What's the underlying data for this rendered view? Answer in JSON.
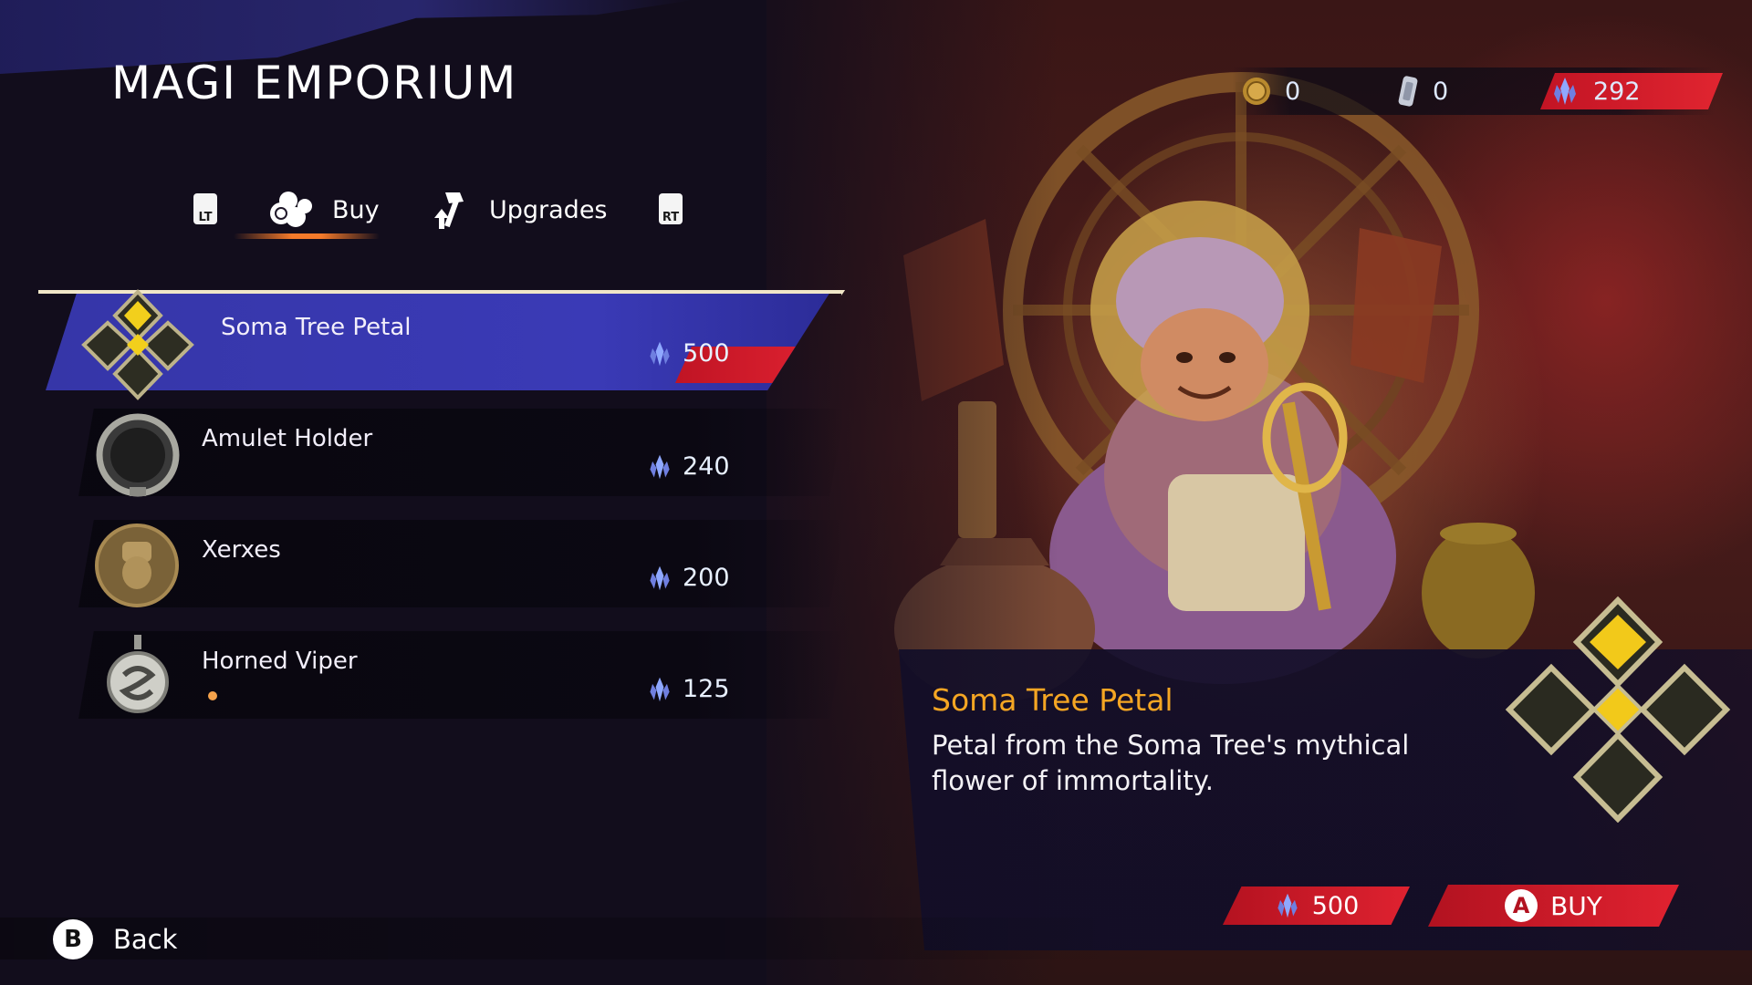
{
  "header": {
    "title": "MAGI EMPORIUM"
  },
  "tabs": {
    "left_trigger": "LT",
    "right_trigger": "RT",
    "items": [
      {
        "label": "Buy",
        "icon": "coins-icon",
        "active": true
      },
      {
        "label": "Upgrades",
        "icon": "hammer-upgrade-icon",
        "active": false
      }
    ]
  },
  "currencies": {
    "gold_coins": "0",
    "tokens": "0",
    "time_crystals": "292"
  },
  "items": [
    {
      "name": "Soma Tree Petal",
      "price": "500",
      "icon": "soma-petal-icon",
      "selected": true
    },
    {
      "name": "Amulet Holder",
      "price": "240",
      "icon": "amulet-holder-icon",
      "selected": false
    },
    {
      "name": "Xerxes",
      "price": "200",
      "icon": "xerxes-coin-icon",
      "selected": false
    },
    {
      "name": "Horned Viper",
      "price": "125",
      "icon": "horned-viper-icon",
      "selected": false,
      "new": true
    }
  ],
  "detail": {
    "title": "Soma Tree Petal",
    "description": "Petal from the Soma Tree's mythical flower of immortality.",
    "price": "500",
    "buy_button": "BUY",
    "buy_glyph": "A"
  },
  "footer": {
    "back_glyph": "B",
    "back_label": "Back"
  },
  "colors": {
    "accent_orange": "#f5a623",
    "price_red": "#e02230",
    "selected_blue": "#3a3ab6"
  }
}
